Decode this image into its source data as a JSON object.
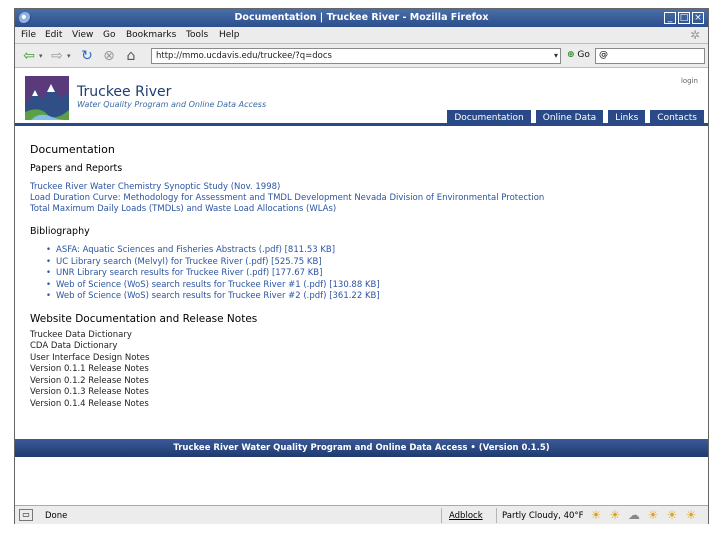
{
  "window": {
    "title": "Documentation | Truckee River - Mozilla Firefox"
  },
  "menu": [
    "File",
    "Edit",
    "View",
    "Go",
    "Bookmarks",
    "Tools",
    "Help"
  ],
  "toolbar": {
    "url": "http://mmo.ucdavis.edu/truckee/?q=docs",
    "go_label": "Go",
    "search_value": ""
  },
  "site": {
    "title": "Truckee River",
    "subtitle": "Water Quality Program and Online Data Access",
    "login": "login",
    "tabs": [
      "Documentation",
      "Online Data",
      "Links",
      "Contacts"
    ]
  },
  "page": {
    "heading": "Documentation",
    "papers": {
      "heading": "Papers and Reports",
      "items": [
        "Truckee River Water Chemistry Synoptic Study (Nov. 1998)",
        "Load Duration Curve: Methodology for Assessment and TMDL Development Nevada Division of Environmental Protection",
        "Total Maximum Daily Loads (TMDLs) and Waste Load Allocations (WLAs)"
      ]
    },
    "bibliography": {
      "heading": "Bibliography",
      "items": [
        "ASFA: Aquatic Sciences and Fisheries Abstracts (.pdf) [811.53 KB]",
        "UC Library search (Melvyl) for Truckee River (.pdf) [525.75 KB]",
        "UNR Library search results for Truckee River (.pdf) [177.67 KB]",
        "Web of Science (WoS) search results for Truckee River #1 (.pdf) [130.88 KB]",
        "Web of Science (WoS) search results for Truckee River #2 (.pdf) [361.22 KB]"
      ]
    },
    "website_docs": {
      "heading": "Website Documentation and Release Notes",
      "items": [
        "Truckee Data Dictionary",
        "CDA Data Dictionary",
        "User Interface Design Notes",
        "Version 0.1.1 Release Notes",
        "Version 0.1.2 Release Notes",
        "Version 0.1.3 Release Notes",
        "Version 0.1.4 Release Notes"
      ]
    },
    "footer": "Truckee River Water Quality Program and Online Data Access • (Version 0.1.5)"
  },
  "status": {
    "text": "Done",
    "adblock": "Adblock",
    "weather": "Partly Cloudy, 40°F"
  },
  "colors": {
    "nav_blue": "#2a4a87",
    "link_blue": "#2b55a2"
  }
}
